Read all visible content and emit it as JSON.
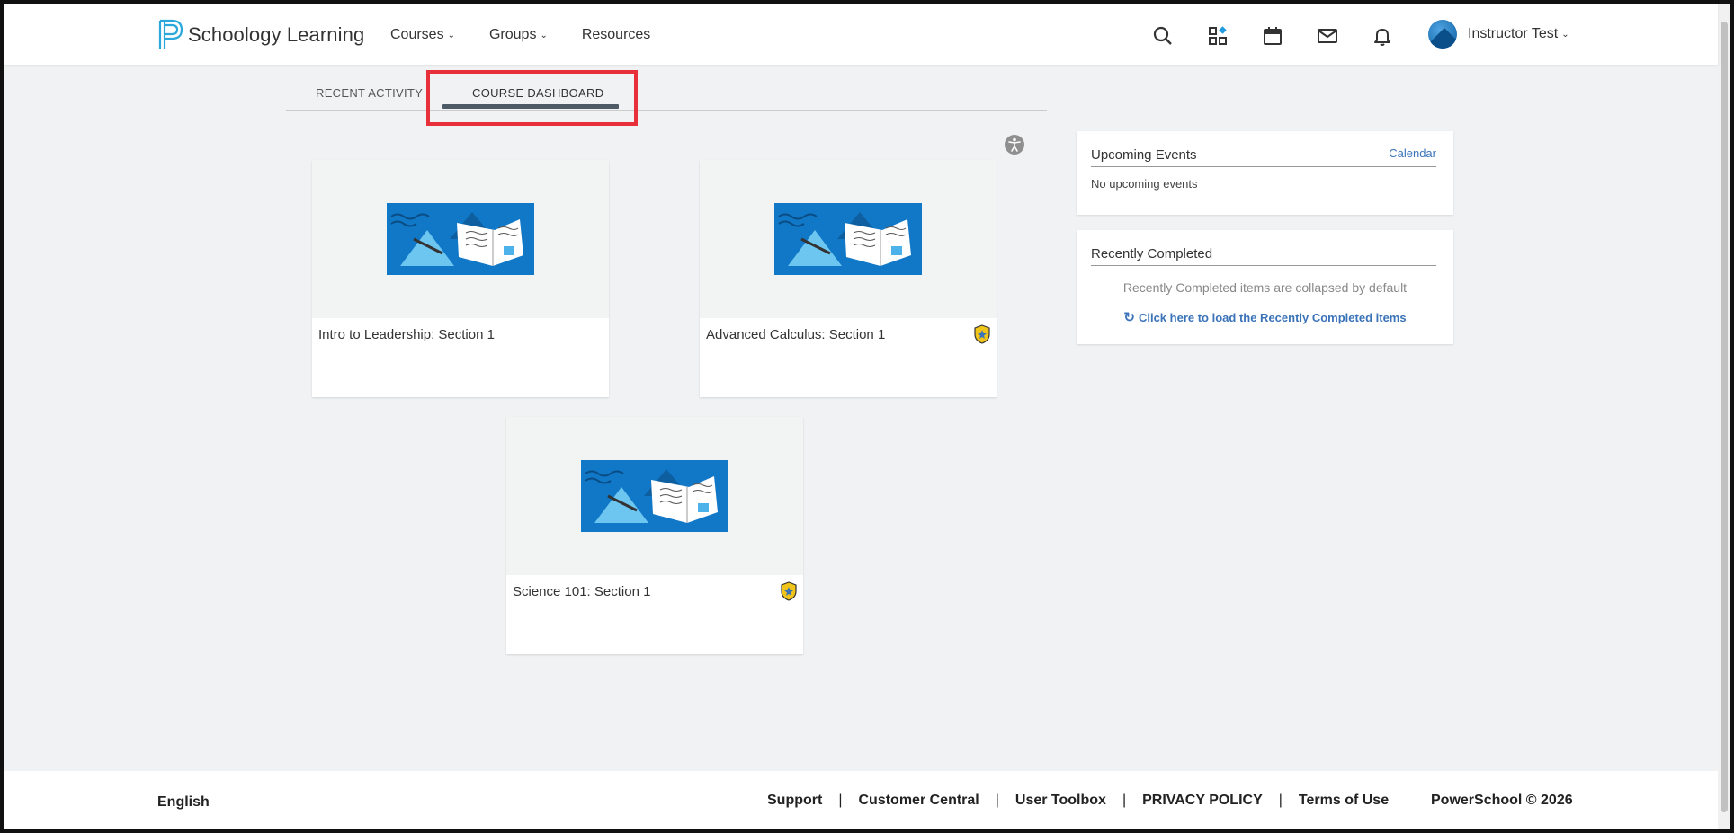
{
  "header": {
    "logo_text": "Schoology Learning",
    "nav": [
      {
        "label": "Courses"
      },
      {
        "label": "Groups"
      },
      {
        "label": "Resources"
      }
    ],
    "icons": [
      "search-icon",
      "apps-icon",
      "calendar-icon",
      "mail-icon",
      "bell-icon"
    ],
    "user_name": "Instructor Test"
  },
  "tabs": {
    "recent": "RECENT ACTIVITY",
    "dashboard": "COURSE DASHBOARD",
    "active": "COURSE DASHBOARD"
  },
  "courses": [
    {
      "title": "Intro to Leadership: Section 1",
      "badge": false
    },
    {
      "title": "Advanced Calculus: Section 1",
      "badge": true
    },
    {
      "title": "Science 101: Section 1",
      "badge": true
    }
  ],
  "upcoming": {
    "title": "Upcoming Events",
    "link": "Calendar",
    "empty_text": "No upcoming events"
  },
  "completed": {
    "title": "Recently Completed",
    "note": "Recently Completed items are collapsed by default",
    "load_link": "Click here to load the Recently Completed items"
  },
  "footer": {
    "language": "English",
    "links": [
      "Support",
      "Customer Central",
      "User Toolbox",
      "PRIVACY POLICY",
      "Terms of Use"
    ],
    "copyright": "PowerSchool © 2026"
  },
  "colors": {
    "accent_blue": "#3b73b9",
    "highlight_red": "#e8303a",
    "badge_yellow": "#f0c419",
    "card_image_blue": "#1178c8"
  }
}
